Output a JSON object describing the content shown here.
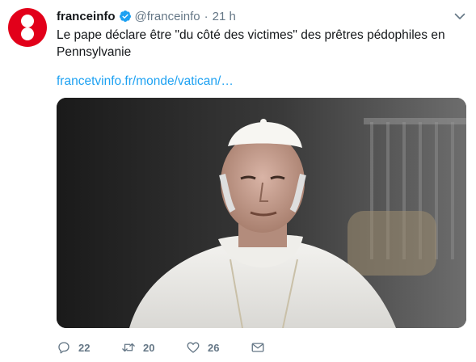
{
  "account": {
    "name": "franceinfo",
    "handle": "@franceinfo",
    "separator": "·",
    "time": "21 h",
    "verified": true
  },
  "tweet": {
    "text": "Le pape déclare être \"du côté des victimes\" des prêtres pédophiles en Pennsylvanie",
    "link": "francetvinfo.fr/monde/vatican/…"
  },
  "media": {
    "alt": "photo"
  },
  "actions": {
    "reply_count": "22",
    "retweet_count": "20",
    "like_count": "26"
  },
  "colors": {
    "brand": "#e2001a",
    "link": "#1da1f2",
    "muted": "#657786",
    "verified": "#1da1f2"
  }
}
